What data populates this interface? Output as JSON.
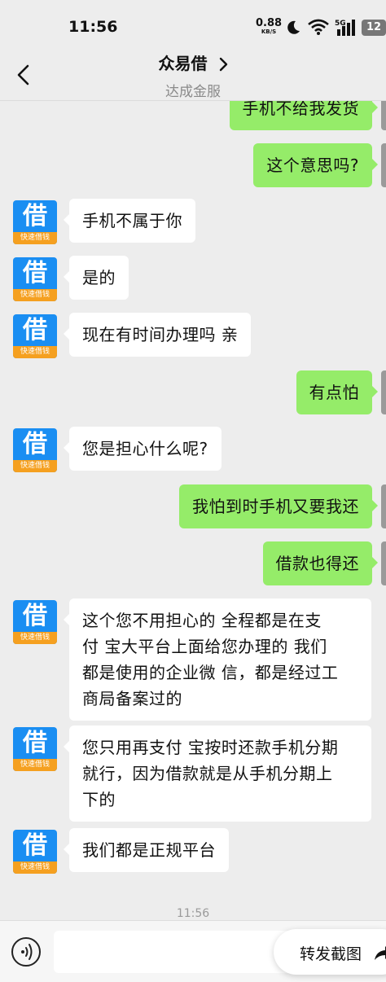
{
  "status_bar": {
    "time": "11:56",
    "net_speed_value": "0.88",
    "net_speed_unit": "KB/S",
    "network": "5G",
    "battery": "12"
  },
  "header": {
    "title": "众易借",
    "subtitle": "达成金服"
  },
  "contact_avatar": {
    "main_char": "借",
    "band_text": "快速借钱"
  },
  "messages": [
    {
      "sender": "me",
      "text": "手机不给我发货"
    },
    {
      "sender": "me",
      "text": "这个意思吗?"
    },
    {
      "sender": "contact",
      "text": "手机不属于你"
    },
    {
      "sender": "contact",
      "text": "是的"
    },
    {
      "sender": "contact",
      "text": "现在有时间办理吗 亲"
    },
    {
      "sender": "me",
      "text": "有点怕"
    },
    {
      "sender": "contact",
      "text": "您是担心什么呢?"
    },
    {
      "sender": "me",
      "text": "我怕到时手机又要我还"
    },
    {
      "sender": "me",
      "text": "借款也得还"
    },
    {
      "sender": "contact",
      "lines": [
        "这个您不用担心的 全程都是在支",
        "付 宝大平台上面给您办理的 我们",
        "都是使用的企业微 信，都是经过工",
        "商局备案过的"
      ]
    },
    {
      "sender": "contact",
      "lines": [
        "您只用再支付 宝按时还款手机分期",
        "就行，因为借款就是从手机分期上",
        "下的"
      ]
    },
    {
      "sender": "contact",
      "text": "我们都是正规平台"
    }
  ],
  "timestamp": "11:56",
  "input_bar": {
    "share_label": "转发截图"
  },
  "colors": {
    "background": "#ededed",
    "outgoing_bubble": "#95ec69",
    "incoming_bubble": "#ffffff",
    "avatar_blue": "#1a8ef2",
    "avatar_orange": "#f5a020"
  }
}
